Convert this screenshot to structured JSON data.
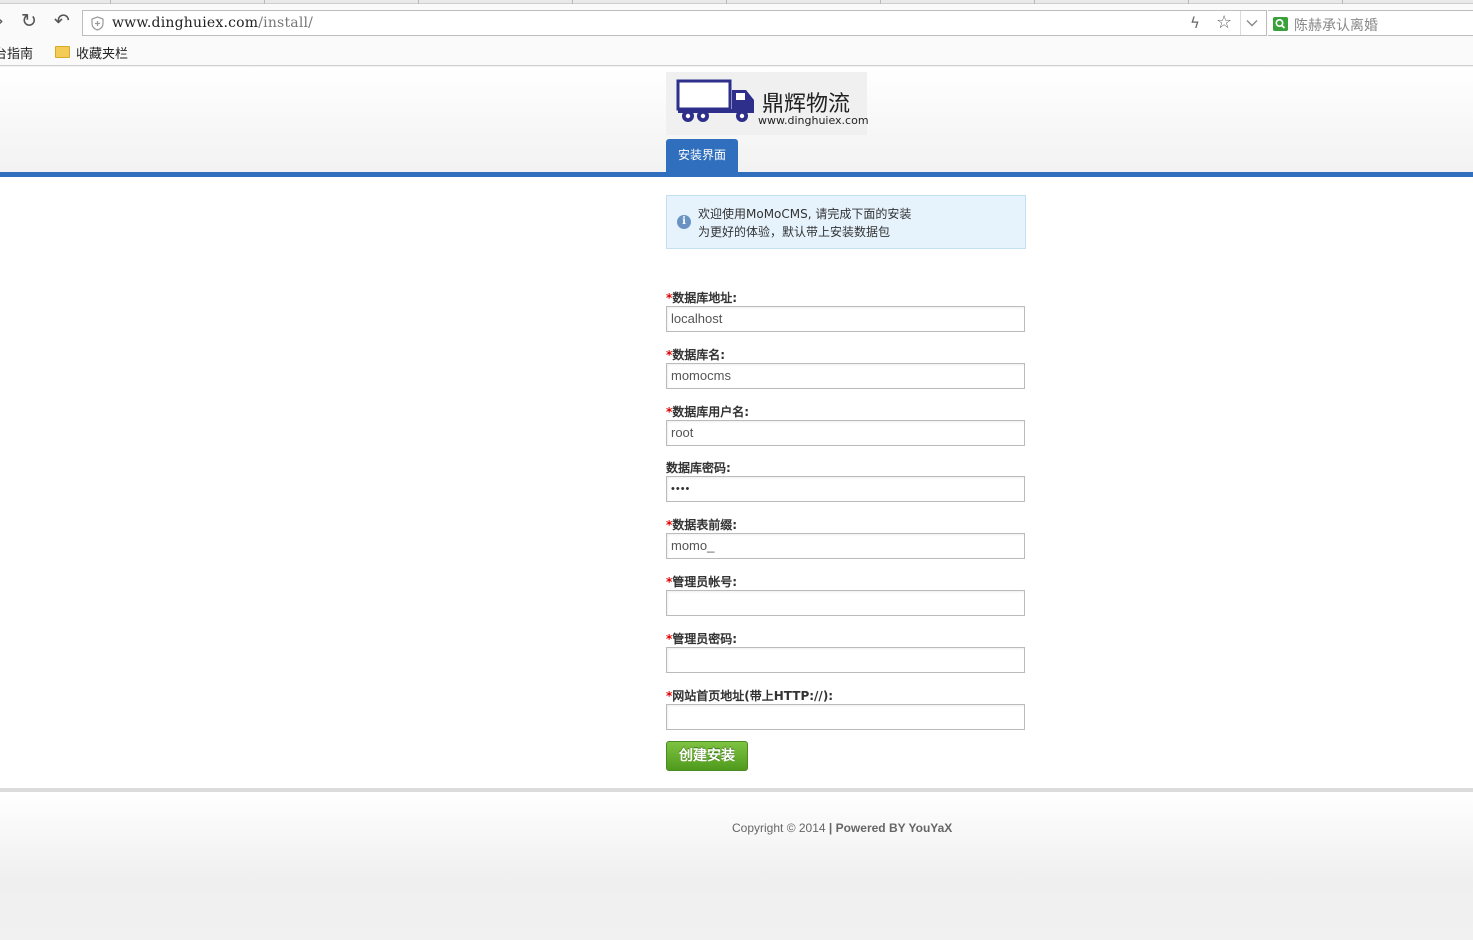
{
  "browser": {
    "url_host": "www.dinghuiex.com",
    "url_path": "/install/",
    "search_text": "陈赫承认离婚",
    "bookmarks": [
      "台指南",
      "收藏夹栏"
    ]
  },
  "header": {
    "brand": "鼎辉物流",
    "site": "www.dinghuiex.com",
    "nav_tab": "安装界面"
  },
  "info": {
    "line1": "欢迎使用MoMoCMS, 请完成下面的安装",
    "line2": "为更好的体验，默认带上安装数据包"
  },
  "form": {
    "fields": [
      {
        "required": "*",
        "label": "数据库地址:",
        "value": "localhost"
      },
      {
        "required": "*",
        "label": "数据库名:",
        "value": "momocms"
      },
      {
        "required": "*",
        "label": "数据库用户名:",
        "value": "root"
      },
      {
        "required": "",
        "label": "数据库密码:",
        "value": "••••"
      },
      {
        "required": "*",
        "label": "数据表前缀:",
        "value": "momo_"
      },
      {
        "required": "*",
        "label": "管理员帐号:",
        "value": ""
      },
      {
        "required": "*",
        "label": "管理员密码:",
        "value": ""
      },
      {
        "required": "*",
        "label": "网站首页地址(带上HTTP://):",
        "value": ""
      }
    ],
    "submit_label": "创建安装"
  },
  "footer": {
    "copyright": "Copyright © 2014",
    "powered": "| Powered BY YouYaX"
  },
  "colors": {
    "accent": "#2f6fbd",
    "info_bg": "#e6f3fd",
    "button_green": "#5fa82a",
    "required": "#dd0000"
  }
}
